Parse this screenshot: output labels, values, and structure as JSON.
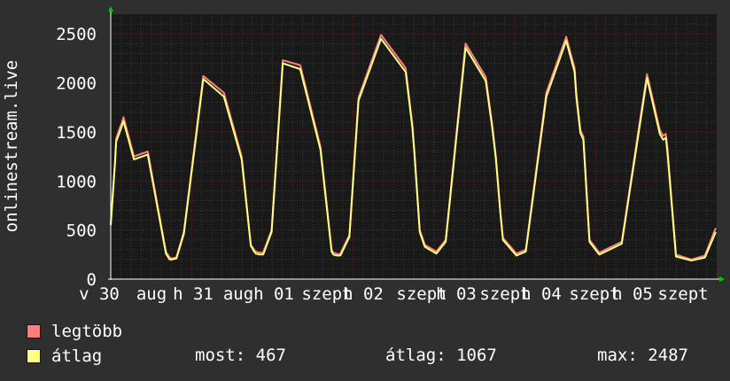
{
  "chart_data": {
    "type": "line",
    "ylabel": "onlinestream.live",
    "ylim": [
      0,
      2700
    ],
    "yticks": [
      0,
      500,
      1000,
      1500,
      2000,
      2500
    ],
    "xticks": [
      "v 30",
      "aug",
      "h 31",
      "aug",
      "h 01",
      "szept",
      "h 02",
      "szept",
      "h 03",
      "szept",
      "h 04",
      "szept",
      "h 05",
      "szept"
    ],
    "x_keypoints": [
      0,
      1.3,
      1.6,
      2.9,
      3.3,
      3.8,
      6.9,
      11.0,
      16.4,
      17.5,
      18.1,
      19.5,
      21.7,
      27.5,
      33.6,
      38.9,
      41.6,
      42.6,
      43.1,
      44.2,
      45.3,
      47.8,
      51.1,
      56.3,
      62.3,
      65.6,
      66.1,
      67.1,
      67.7,
      68.2,
      70.9,
      73.6,
      80.3,
      87.6,
      89.6,
      90.2,
      91.8,
      93.3,
      96.7,
      99.5,
      105.4,
      111.4,
      113.3,
      114.4,
      115.7,
      116.5,
      120.5,
      123.3,
      129.4,
      135.3,
      137.8,
      138.3,
      139.5,
      140.4,
      142.2,
      145.1,
      151.8,
      159.3,
      163.1,
      164.1,
      164.9,
      165.4,
      167.9,
      172.5,
      176.5,
      179.7
    ],
    "series": [
      {
        "name": "legtöbb",
        "color": "#ff7f7f",
        "values": [
          550,
          1200,
          1430,
          1560,
          1590,
          1650,
          1250,
          1300,
          280,
          220,
          210,
          220,
          480,
          2070,
          1900,
          1250,
          350,
          300,
          280,
          270,
          270,
          500,
          2230,
          2180,
          1350,
          300,
          270,
          260,
          250,
          260,
          450,
          1850,
          2490,
          2150,
          1570,
          1300,
          500,
          350,
          280,
          400,
          2400,
          2060,
          1580,
          1250,
          700,
          420,
          260,
          300,
          1900,
          2470,
          2150,
          1900,
          1520,
          1450,
          400,
          270,
          380,
          2090,
          1520,
          1460,
          1480,
          1320,
          250,
          200,
          240,
          520
        ]
      },
      {
        "name": "átlag",
        "color": "#ffff80",
        "values": [
          550,
          1200,
          1400,
          1520,
          1560,
          1610,
          1220,
          1270,
          260,
          200,
          200,
          210,
          460,
          2040,
          1860,
          1220,
          340,
          280,
          260,
          250,
          250,
          480,
          2200,
          2140,
          1320,
          280,
          250,
          240,
          240,
          240,
          430,
          1820,
          2450,
          2110,
          1540,
          1280,
          480,
          330,
          260,
          380,
          2360,
          2020,
          1550,
          1230,
          680,
          400,
          240,
          280,
          1860,
          2430,
          2110,
          1860,
          1490,
          1420,
          380,
          250,
          360,
          2050,
          1480,
          1420,
          1440,
          1280,
          230,
          190,
          220,
          480
        ]
      }
    ]
  },
  "legend": [
    {
      "label": "legtöbb",
      "color": "#ff7f7f"
    },
    {
      "label": "átlag",
      "color": "#ffff80"
    }
  ],
  "stats": {
    "now": "most: 467",
    "avg": "átlag: 1067",
    "max": "max: 2487"
  }
}
